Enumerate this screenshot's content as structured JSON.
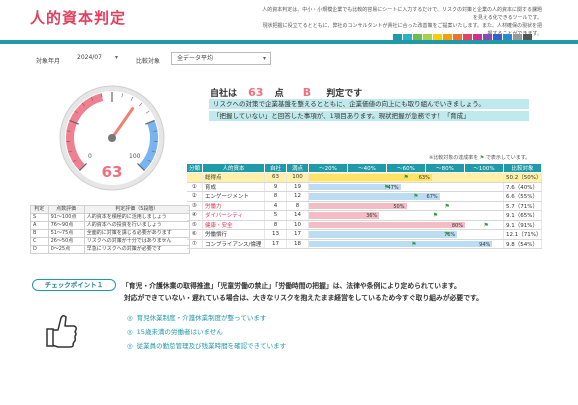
{
  "header": {
    "title": "人的資本判定",
    "desc_lines": [
      "人的資本判定は、中小・小規模企業でも比較的容易にシートに入力するだけで、リスクの対策と企業の人的資本に関する課題を見える化できるツールです。",
      "現状把握に役立てるとともに、弊社のコンサルタントが貴社に合った改善策をご提案いたします。また、人材確保の現状を把握することができます。"
    ]
  },
  "colors": {
    "accent": "#1e9aa8",
    "title": "#e04060",
    "swatches": [
      "#1e9aa8",
      "#2bb3c0",
      "#6cc04a",
      "#a6d24a",
      "#f5d000",
      "#f5a000",
      "#f07030",
      "#e84060",
      "#d0308a",
      "#8a4ab0",
      "#3a5ec8",
      "#2a8ad0",
      "#999999",
      "#555555"
    ]
  },
  "filters": {
    "period_label": "対象年月",
    "period_value": "2024/07",
    "compare_label": "比較対象",
    "compare_value": "全データ平均"
  },
  "gauge": {
    "value": 63,
    "min_label": "0",
    "max_label": "100"
  },
  "criteria_table": {
    "headers": [
      "判定",
      "点数評価",
      "判定評価（5段階）"
    ],
    "rows": [
      [
        "S",
        "91〜100点",
        "人的資本を積極的に活用しましょう"
      ],
      [
        "A",
        "76〜90点",
        "人的資本への投資を行いましょう"
      ],
      [
        "B",
        "51〜75点",
        "全面的に対策を講じる必要があります"
      ],
      [
        "C",
        "26〜50点",
        "リスクへの対策が十分ではありません"
      ],
      [
        "D",
        "0〜25点",
        "早急にリスクへの対策が必要です"
      ]
    ]
  },
  "summary": {
    "prefix": "自社は",
    "score": "63",
    "unit": "点",
    "grade": "B",
    "suffix": "判定です",
    "message1": "リスクへの対策で企業基盤を整えるとともに、企業価値の向上にも取り組んでいきましょう。",
    "message2": "「把握していない」と回答した事項が、1項目あります。現状把握が急務です！「育成」"
  },
  "legend_note": {
    "text": "※比較対象の達成率を",
    "flag": "⚑",
    "suffix": "で表示しています。"
  },
  "category_table": {
    "headers": [
      "分類",
      "人的資本",
      "自社",
      "満点",
      "〜20%",
      "〜40%",
      "〜60%",
      "〜80%",
      "〜100%",
      "比較対象"
    ],
    "rows": [
      {
        "no": "",
        "name": "総得点",
        "self": "63",
        "max": "100",
        "pct": 63,
        "pct_label": "63%",
        "bar": "yellow",
        "flag_pct": 50,
        "ratio": "50.2（50%）",
        "highlight": true,
        "red": false
      },
      {
        "no": "①",
        "name": "育成",
        "self": "9",
        "max": "19",
        "pct": 47,
        "pct_label": "47%",
        "bar": "blue",
        "flag_pct": 40,
        "ratio": "7.6（40%）",
        "highlight": false,
        "red": false
      },
      {
        "no": "②",
        "name": "エンゲージメント",
        "self": "8",
        "max": "12",
        "pct": 67,
        "pct_label": "67%",
        "bar": "blue",
        "flag_pct": 55,
        "ratio": "6.6（55%）",
        "highlight": false,
        "red": false
      },
      {
        "no": "③",
        "name": "労働力",
        "self": "4",
        "max": "8",
        "pct": 50,
        "pct_label": "50%",
        "bar": "red",
        "flag_pct": 71,
        "ratio": "5.7（71%）",
        "highlight": false,
        "red": true
      },
      {
        "no": "④",
        "name": "ダイバーシティ",
        "self": "5",
        "max": "14",
        "pct": 36,
        "pct_label": "36%",
        "bar": "red",
        "flag_pct": 65,
        "ratio": "9.1（65%）",
        "highlight": false,
        "red": true
      },
      {
        "no": "⑤",
        "name": "健康・安全",
        "self": "8",
        "max": "10",
        "pct": 80,
        "pct_label": "80%",
        "bar": "red",
        "flag_pct": 91,
        "ratio": "9.1（91%）",
        "highlight": false,
        "red": true
      },
      {
        "no": "⑥",
        "name": "労働慣行",
        "self": "13",
        "max": "17",
        "pct": 76,
        "pct_label": "76%",
        "bar": "blue",
        "flag_pct": 71,
        "ratio": "12.1（71%）",
        "highlight": false,
        "red": false
      },
      {
        "no": "⑦",
        "name": "コンプライアンス/倫理",
        "self": "17",
        "max": "18",
        "pct": 94,
        "pct_label": "94%",
        "bar": "blue",
        "flag_pct": 54,
        "ratio": "9.8（54%）",
        "highlight": false,
        "red": false
      }
    ]
  },
  "checkpoint": {
    "badge": "チェックポイント１",
    "line1": "「育児・介護休業の取得推進」「児童労働の禁止」「労働時間の把握」は、法律や条例により定められています。",
    "line2": "対応ができていない・遅れている場合は、大きなリスクを抱えたまま経営をしているため今すぐ取り組みが必要です。",
    "items": [
      "育児休業制度・介護休業制度が整っています",
      "15歳未満の労働者はいません",
      "従業員の勤怠管理及び残業時間を確認できています"
    ]
  }
}
